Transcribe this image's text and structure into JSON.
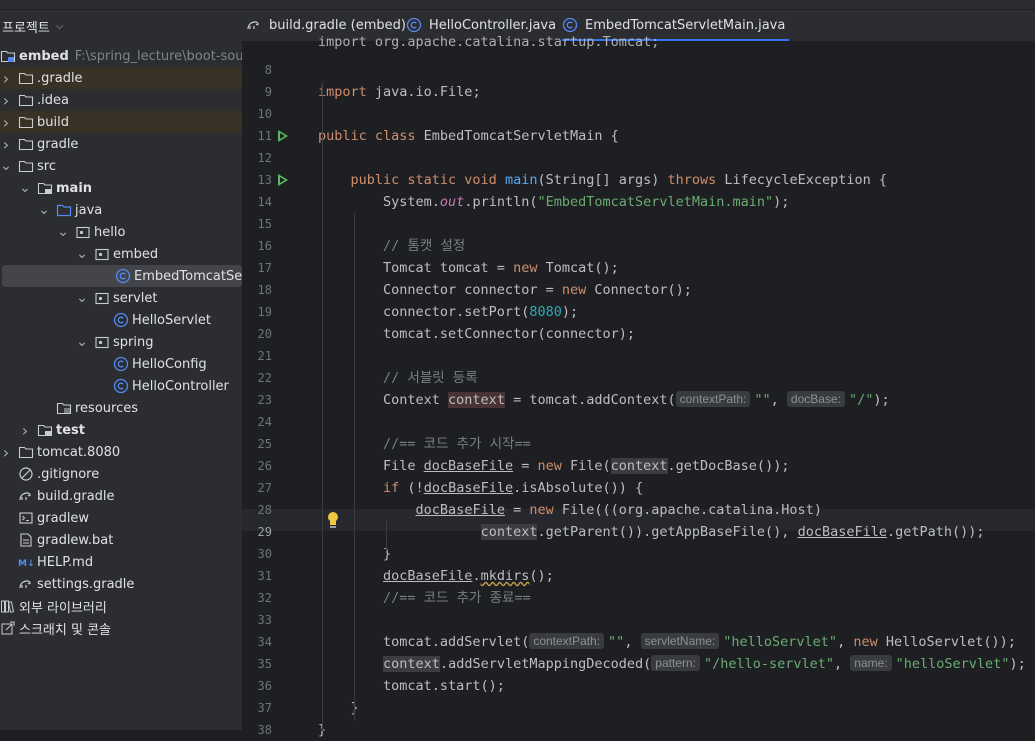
{
  "panel": {
    "title": "프로젝트",
    "tree": [
      {
        "label": "embed",
        "hint": "F:\\spring_lecture\\boot-source",
        "icon": "module-folder-icon",
        "arrow": "",
        "indent": 0,
        "bold": true
      },
      {
        "label": ".gradle",
        "icon": "folder-icon",
        "arrow": "right",
        "indent": 1,
        "excluded": true
      },
      {
        "label": ".idea",
        "icon": "folder-icon",
        "arrow": "right",
        "indent": 1
      },
      {
        "label": "build",
        "icon": "folder-icon",
        "arrow": "right",
        "indent": 1,
        "excluded": true
      },
      {
        "label": "gradle",
        "icon": "folder-icon",
        "arrow": "right",
        "indent": 1
      },
      {
        "label": "src",
        "icon": "folder-icon",
        "arrow": "down",
        "indent": 1
      },
      {
        "label": "main",
        "icon": "source-root-folder-icon",
        "arrow": "down",
        "indent": 2,
        "bold": true
      },
      {
        "label": "java",
        "icon": "java-source-folder-icon",
        "arrow": "down",
        "indent": 3
      },
      {
        "label": "hello",
        "icon": "package-icon",
        "arrow": "down",
        "indent": 4
      },
      {
        "label": "embed",
        "icon": "package-icon",
        "arrow": "down",
        "indent": 5
      },
      {
        "label": "EmbedTomcatServletMain",
        "icon": "java-class-icon",
        "arrow": "",
        "indent": 6,
        "selected": true
      },
      {
        "label": "servlet",
        "icon": "package-icon",
        "arrow": "down",
        "indent": 5
      },
      {
        "label": "HelloServlet",
        "icon": "java-class-icon",
        "arrow": "",
        "indent": 6
      },
      {
        "label": "spring",
        "icon": "package-icon",
        "arrow": "down",
        "indent": 5
      },
      {
        "label": "HelloConfig",
        "icon": "java-class-icon",
        "arrow": "",
        "indent": 6
      },
      {
        "label": "HelloController",
        "icon": "java-class-icon",
        "arrow": "",
        "indent": 6
      },
      {
        "label": "resources",
        "icon": "resources-folder-icon",
        "arrow": "",
        "indent": 3
      },
      {
        "label": "test",
        "icon": "source-root-folder-icon",
        "arrow": "right",
        "indent": 2,
        "bold": true
      },
      {
        "label": "tomcat.8080",
        "icon": "folder-icon",
        "arrow": "right",
        "indent": 1
      },
      {
        "label": ".gitignore",
        "icon": "ignore-file-icon",
        "arrow": "",
        "indent": 1
      },
      {
        "label": "build.gradle",
        "icon": "gradle-icon",
        "arrow": "",
        "indent": 1
      },
      {
        "label": "gradlew",
        "icon": "terminal-file-icon",
        "arrow": "",
        "indent": 1
      },
      {
        "label": "gradlew.bat",
        "icon": "text-file-icon",
        "arrow": "",
        "indent": 1
      },
      {
        "label": "HELP.md",
        "icon": "markdown-icon",
        "arrow": "",
        "indent": 1
      },
      {
        "label": "settings.gradle",
        "icon": "gradle-icon",
        "arrow": "",
        "indent": 1
      },
      {
        "label": "외부 라이브러리",
        "icon": "libraries-icon",
        "arrow": "",
        "indent": 0
      },
      {
        "label": "스크래치 및 콘솔",
        "icon": "scratches-icon",
        "arrow": "",
        "indent": 0
      }
    ]
  },
  "tabs": [
    {
      "label": "build.gradle (embed)",
      "icon": "gradle-icon",
      "active": false
    },
    {
      "label": "HelloController.java",
      "icon": "java-class-icon",
      "active": false
    },
    {
      "label": "EmbedTomcatServletMain.java",
      "icon": "java-class-icon",
      "active": true
    }
  ],
  "editor": {
    "current_line": 29,
    "run_lines": [
      11,
      13
    ],
    "lines": [
      {
        "n": "",
        "segs": [
          [
            "",
            "import org.apache.catalina.startup.Tomcat;"
          ]
        ]
      },
      {
        "n": "8",
        "segs": []
      },
      {
        "n": "9",
        "segs": [
          [
            "kw",
            "import "
          ],
          [
            "",
            "java.io.File;"
          ]
        ]
      },
      {
        "n": "10",
        "segs": []
      },
      {
        "n": "11",
        "segs": [
          [
            "kw",
            "public class "
          ],
          [
            "",
            "EmbedTomcatServletMain {"
          ]
        ]
      },
      {
        "n": "12",
        "segs": []
      },
      {
        "n": "13",
        "segs": [
          [
            "",
            "    "
          ],
          [
            "kw",
            "public static void "
          ],
          [
            "fn",
            "main"
          ],
          [
            "",
            "(String[] args) "
          ],
          [
            "kw",
            "throws "
          ],
          [
            "",
            "LifecycleException {"
          ]
        ]
      },
      {
        "n": "14",
        "segs": [
          [
            "",
            "        System."
          ],
          [
            "it",
            "out"
          ],
          [
            "",
            ".println("
          ],
          [
            "st",
            "\"EmbedTomcatServletMain.main\""
          ],
          [
            "",
            ");"
          ]
        ]
      },
      {
        "n": "15",
        "segs": []
      },
      {
        "n": "16",
        "segs": [
          [
            "",
            "        "
          ],
          [
            "cm",
            "// 톰캣 설정"
          ]
        ]
      },
      {
        "n": "17",
        "segs": [
          [
            "",
            "        Tomcat tomcat = "
          ],
          [
            "kw",
            "new "
          ],
          [
            "",
            "Tomcat();"
          ]
        ]
      },
      {
        "n": "18",
        "segs": [
          [
            "",
            "        Connector connector = "
          ],
          [
            "kw",
            "new "
          ],
          [
            "",
            "Connector();"
          ]
        ]
      },
      {
        "n": "19",
        "segs": [
          [
            "",
            "        connector.setPort("
          ],
          [
            "nm",
            "8080"
          ],
          [
            "",
            ");"
          ]
        ]
      },
      {
        "n": "20",
        "segs": [
          [
            "",
            "        tomcat.setConnector(connector);"
          ]
        ]
      },
      {
        "n": "21",
        "segs": []
      },
      {
        "n": "22",
        "segs": [
          [
            "",
            "        "
          ],
          [
            "cm",
            "// 서블릿 등록"
          ]
        ]
      },
      {
        "n": "23",
        "segs": [
          [
            "",
            "        Context "
          ],
          [
            "bgctx",
            "context"
          ],
          [
            "",
            " = tomcat.addContext("
          ],
          [
            "pb",
            "contextPath:"
          ],
          [
            "st",
            "\"\""
          ],
          [
            "",
            ", "
          ],
          [
            "pb",
            "docBase:"
          ],
          [
            "st",
            "\"/\""
          ],
          [
            "",
            ");"
          ]
        ]
      },
      {
        "n": "24",
        "segs": []
      },
      {
        "n": "25",
        "segs": [
          [
            "",
            "        "
          ],
          [
            "cm",
            "//== 코드 추가 시작=="
          ]
        ]
      },
      {
        "n": "26",
        "segs": [
          [
            "",
            "        File "
          ],
          [
            "ul",
            "docBaseFile"
          ],
          [
            "",
            " = "
          ],
          [
            "kw",
            "new "
          ],
          [
            "",
            "File("
          ],
          [
            "hl",
            "context"
          ],
          [
            "",
            ".getDocBase());"
          ]
        ]
      },
      {
        "n": "27",
        "segs": [
          [
            "",
            "        "
          ],
          [
            "kw",
            "if "
          ],
          [
            "",
            "(!"
          ],
          [
            "ul",
            "docBaseFile"
          ],
          [
            "",
            ".isAbsolute()) {"
          ]
        ]
      },
      {
        "n": "28",
        "segs": [
          [
            "",
            "            "
          ],
          [
            "ul",
            "docBaseFile"
          ],
          [
            "",
            " = "
          ],
          [
            "kw",
            "new "
          ],
          [
            "",
            "File(((org.apache.catalina.Host)"
          ]
        ]
      },
      {
        "n": "29",
        "segs": [
          [
            "",
            "                    "
          ],
          [
            "hl",
            "context"
          ],
          [
            "",
            ".getParent()).getAppBaseFile(), "
          ],
          [
            "ul",
            "docBaseFile"
          ],
          [
            "",
            ".getPath());"
          ]
        ]
      },
      {
        "n": "30",
        "segs": [
          [
            "",
            "        }"
          ]
        ]
      },
      {
        "n": "31",
        "segs": [
          [
            "",
            "        "
          ],
          [
            "ul",
            "docBaseFile"
          ],
          [
            "",
            "."
          ],
          [
            "warn",
            "mkdirs"
          ],
          [
            "",
            "();"
          ]
        ]
      },
      {
        "n": "32",
        "segs": [
          [
            "",
            "        "
          ],
          [
            "cm",
            "//== 코드 추가 종료=="
          ]
        ]
      },
      {
        "n": "33",
        "segs": []
      },
      {
        "n": "34",
        "segs": [
          [
            "",
            "        tomcat.addServlet("
          ],
          [
            "pb",
            "contextPath:"
          ],
          [
            "st",
            "\"\""
          ],
          [
            "",
            ", "
          ],
          [
            "pb",
            "servletName:"
          ],
          [
            "st",
            "\"helloServlet\""
          ],
          [
            "",
            ", "
          ],
          [
            "kw",
            "new "
          ],
          [
            "",
            "HelloServlet());"
          ]
        ]
      },
      {
        "n": "35",
        "segs": [
          [
            "",
            "        "
          ],
          [
            "hl",
            "context"
          ],
          [
            "",
            ".addServletMappingDecoded("
          ],
          [
            "pb",
            "pattern:"
          ],
          [
            "st",
            "\"/hello-servlet\""
          ],
          [
            "",
            ", "
          ],
          [
            "pb",
            "name:"
          ],
          [
            "st",
            "\"helloServlet\""
          ],
          [
            "",
            ");"
          ]
        ]
      },
      {
        "n": "36",
        "segs": [
          [
            "",
            "        tomcat.start();"
          ]
        ]
      },
      {
        "n": "37",
        "segs": [
          [
            "",
            "    }"
          ]
        ]
      },
      {
        "n": "38",
        "segs": [
          [
            "",
            "}"
          ]
        ]
      }
    ]
  },
  "colors": {
    "accent": "#3574f0",
    "run": "#5fb865",
    "excluded_bg": "#3a3126",
    "selected_bg": "#43454a"
  }
}
